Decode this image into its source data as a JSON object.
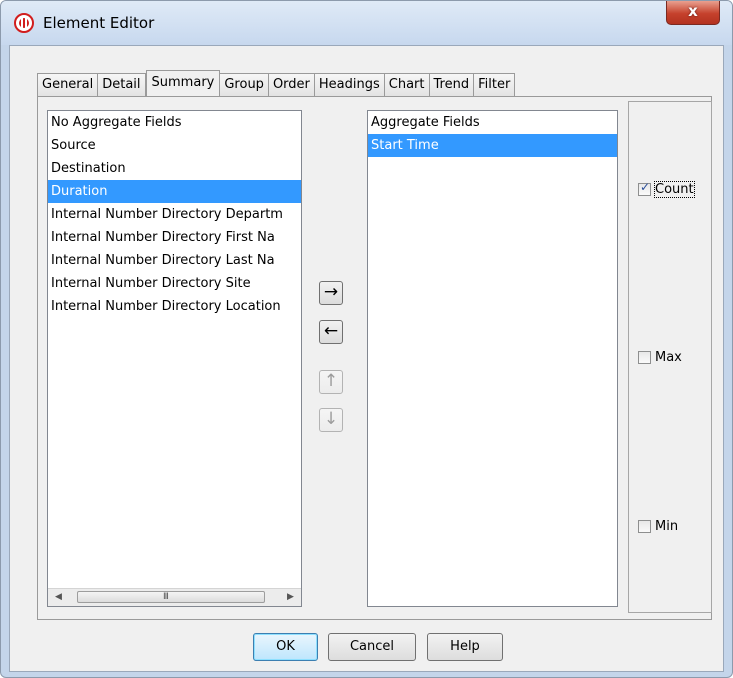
{
  "window": {
    "title": "Element Editor",
    "close_label": "x"
  },
  "tabs": [
    {
      "label": "General",
      "active": false
    },
    {
      "label": "Detail",
      "active": false
    },
    {
      "label": "Summary",
      "active": true
    },
    {
      "label": "Group",
      "active": false
    },
    {
      "label": "Order",
      "active": false
    },
    {
      "label": "Headings",
      "active": false
    },
    {
      "label": "Chart",
      "active": false
    },
    {
      "label": "Trend",
      "active": false
    },
    {
      "label": "Filter",
      "active": false
    }
  ],
  "left_list": {
    "header": "No Aggregate Fields",
    "items": [
      {
        "label": "Source",
        "selected": false
      },
      {
        "label": "Destination",
        "selected": false
      },
      {
        "label": "Duration",
        "selected": true
      },
      {
        "label": "Internal Number Directory Departm",
        "selected": false
      },
      {
        "label": "Internal Number Directory First Na",
        "selected": false
      },
      {
        "label": "Internal Number Directory Last Na",
        "selected": false
      },
      {
        "label": "Internal Number Directory Site",
        "selected": false
      },
      {
        "label": "Internal Number Directory Location",
        "selected": false
      }
    ],
    "scroll_left": "◀",
    "scroll_right": "▶",
    "scroll_grip": "III"
  },
  "right_list": {
    "header": "Aggregate Fields",
    "items": [
      {
        "label": "Start Time",
        "selected": true
      }
    ]
  },
  "move_buttons": {
    "add": "→",
    "remove": "←",
    "up": "↑",
    "down": "↓"
  },
  "aggregates": {
    "count": {
      "label": "Count",
      "checked": true
    },
    "max": {
      "label": "Max",
      "checked": false
    },
    "min": {
      "label": "Min",
      "checked": false
    }
  },
  "buttons": {
    "ok": "OK",
    "cancel": "Cancel",
    "help": "Help"
  },
  "colors": {
    "selection": "#3399ff",
    "close_button": "#c5412c"
  }
}
